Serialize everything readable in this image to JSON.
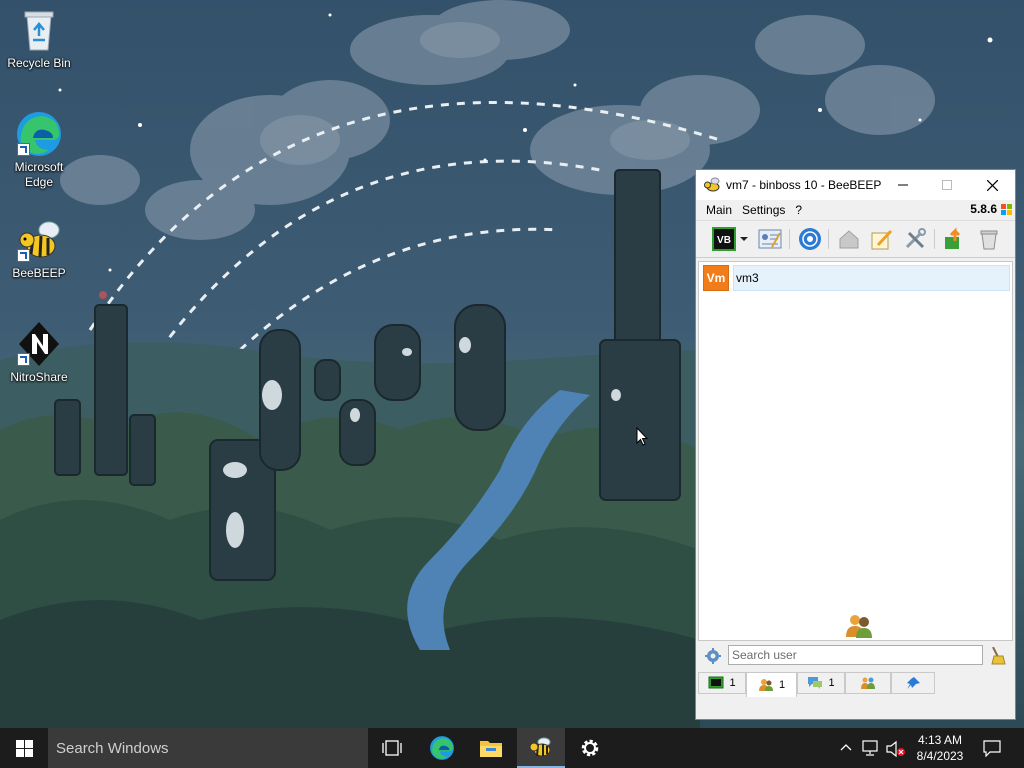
{
  "desktop": {
    "icons": [
      {
        "label": "Recycle Bin"
      },
      {
        "label": "Microsoft Edge"
      },
      {
        "label": "BeeBEEP"
      },
      {
        "label": "NitroShare"
      }
    ]
  },
  "window": {
    "title": "vm7 - binboss 10 - BeeBEEP",
    "menu": {
      "main": "Main",
      "settings": "Settings",
      "help": "?"
    },
    "version": "5.8.6",
    "users": [
      {
        "avatar": "Vm",
        "name": "vm3",
        "avatar_color": "#f07c1a"
      }
    ],
    "search": {
      "placeholder": "Search user"
    },
    "tabs": [
      {
        "icon": "chat-icon",
        "count": "1"
      },
      {
        "icon": "users-icon",
        "count": "1"
      },
      {
        "icon": "messages-icon",
        "count": "1"
      },
      {
        "icon": "groups-icon",
        "count": ""
      },
      {
        "icon": "pin-icon",
        "count": ""
      }
    ]
  },
  "taskbar": {
    "search_placeholder": "Search Windows",
    "time": "4:13 AM",
    "date": "8/4/2023"
  },
  "colors": {
    "taskbar": "#1c1c1c",
    "accent": "#5a8bc7",
    "avatar": "#f07c1a"
  }
}
